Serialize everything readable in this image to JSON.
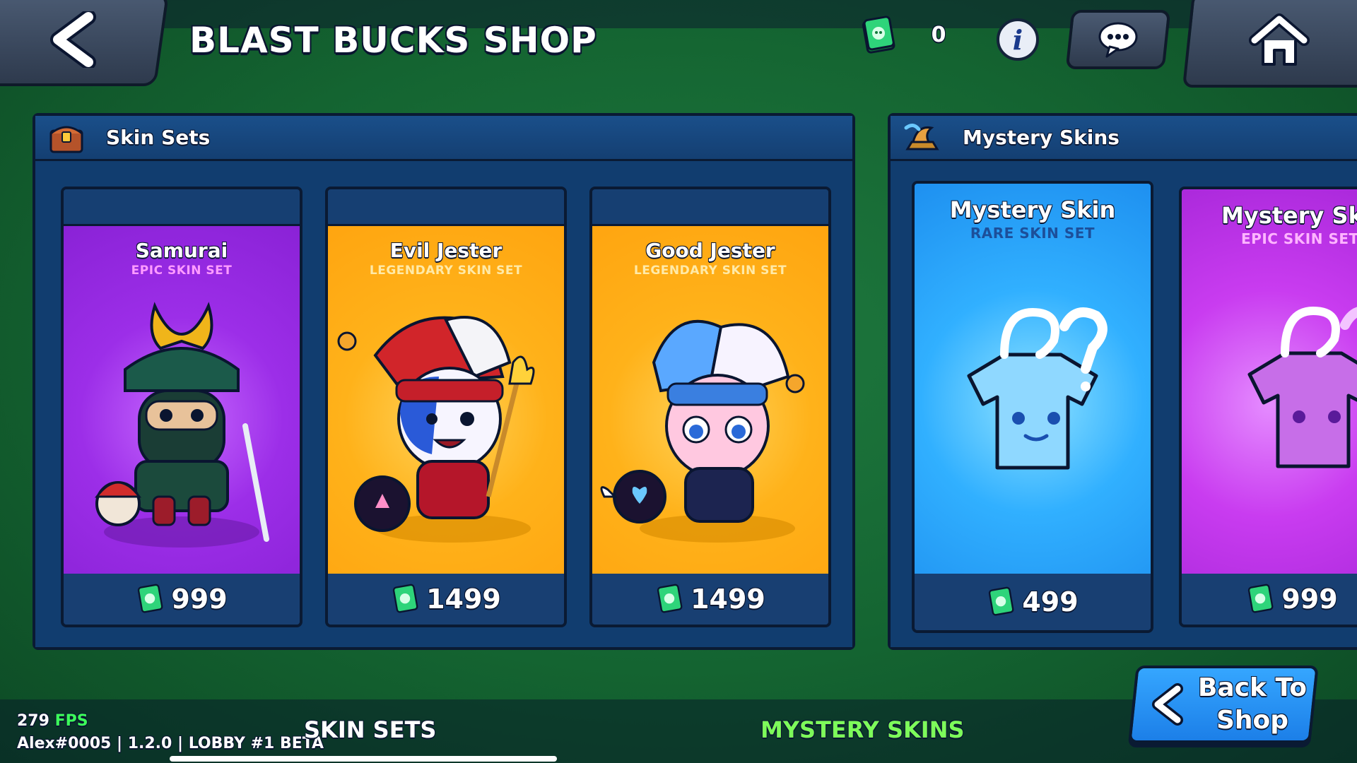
{
  "header": {
    "title": "BLAST BUCKS SHOP",
    "currency_value": "0"
  },
  "skin_sets": {
    "title": "Skin Sets",
    "items": [
      {
        "name": "Samurai",
        "subtitle": "EPIC SKIN SET",
        "price": "999"
      },
      {
        "name": "Evil Jester",
        "subtitle": "LEGENDARY SKIN SET",
        "price": "1499"
      },
      {
        "name": "Good Jester",
        "subtitle": "LEGENDARY SKIN SET",
        "price": "1499"
      }
    ]
  },
  "mystery_skins": {
    "title": "Mystery Skins",
    "items": [
      {
        "name": "Mystery Skin",
        "subtitle": "RARE SKIN SET",
        "price": "499"
      },
      {
        "name": "Mystery Ski",
        "subtitle": "EPIC SKIN SET",
        "price": "999"
      }
    ]
  },
  "footer": {
    "fps_value": "279",
    "fps_label": "FPS",
    "build_info": "Alex#0005 | 1.2.0 | LOBBY #1 BETA",
    "tab_skin_sets": "SKIN SETS",
    "tab_mystery_skins": "MYSTERY SKINS",
    "back_to_shop": "Back To Shop"
  },
  "colors": {
    "background": "#146431",
    "panel": "#113d6f",
    "epic": "#9c2ee8",
    "legendary": "#ffb21a",
    "rare": "#31b0ff",
    "tab_active_green": "#7dfb5a"
  }
}
